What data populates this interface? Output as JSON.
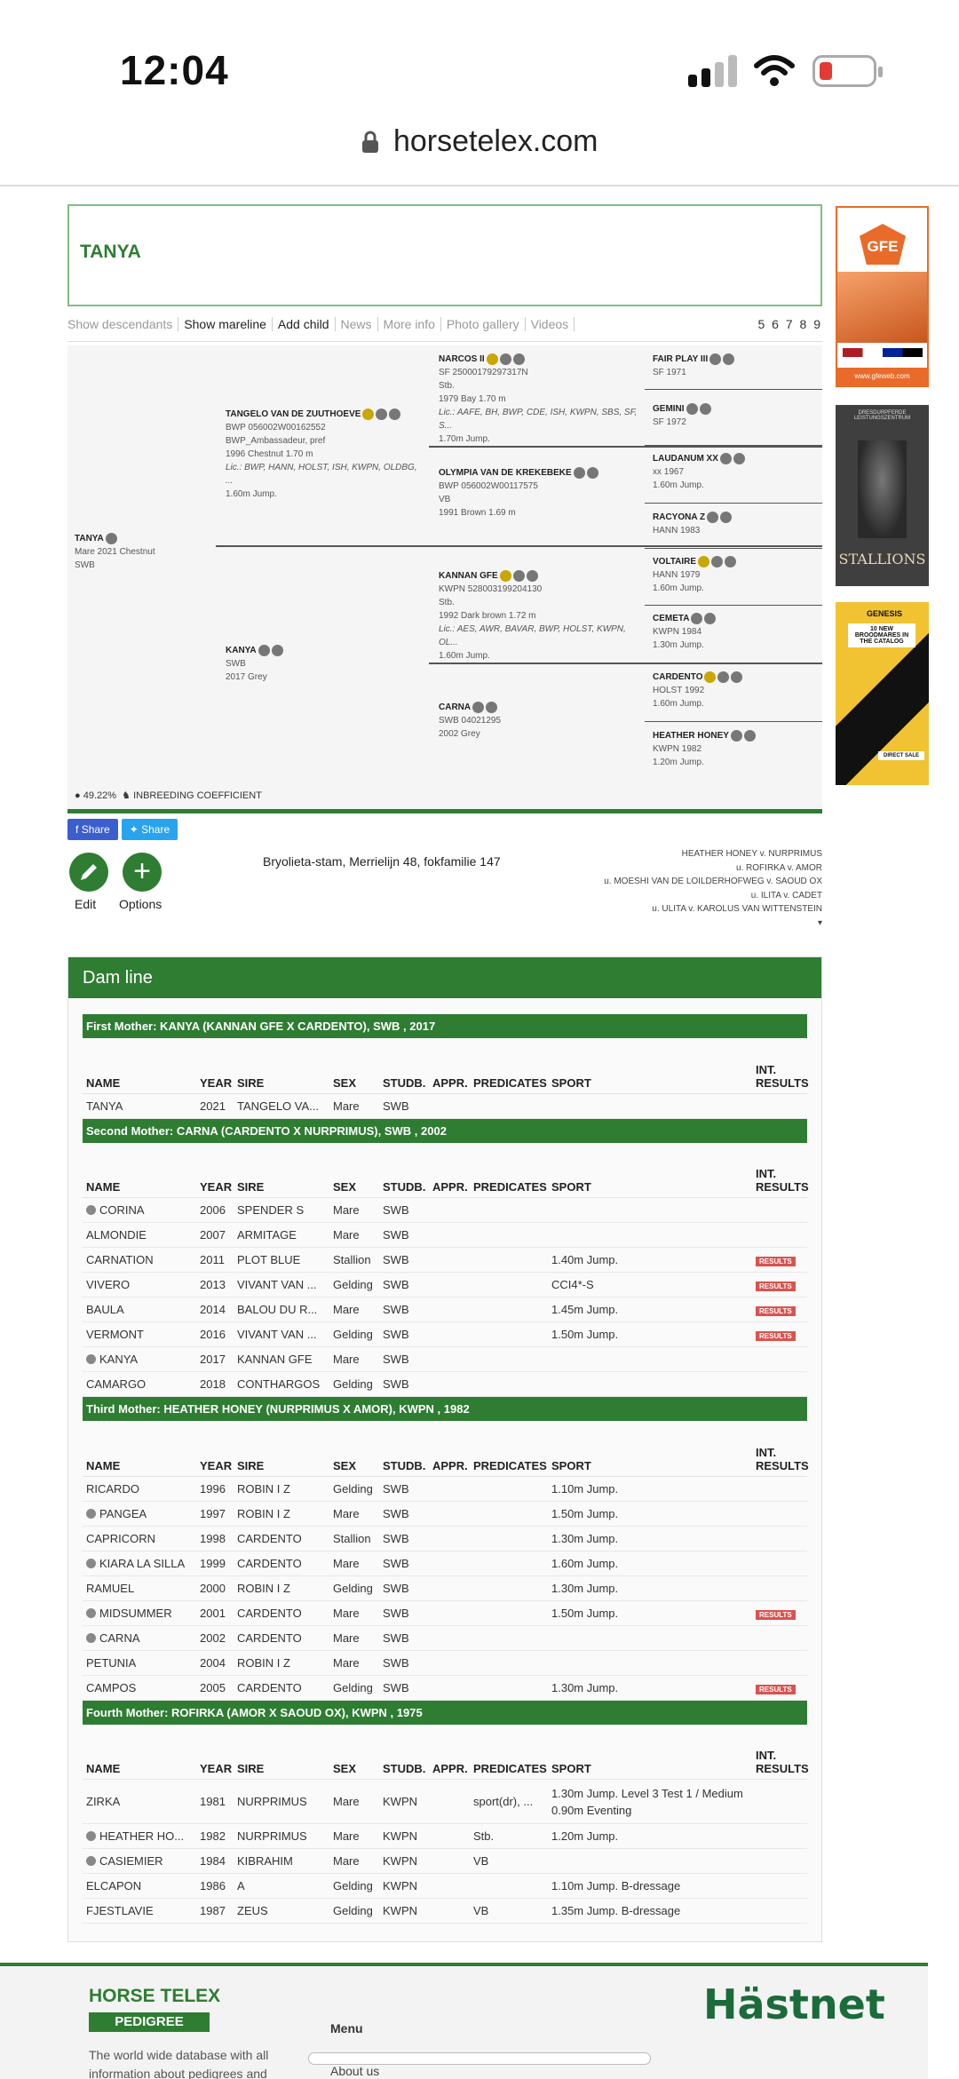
{
  "status": {
    "time": "12:04"
  },
  "browser": {
    "url": "horsetelex.com"
  },
  "horse": {
    "title": "TANYA"
  },
  "nav": {
    "items": [
      "Show descendants",
      "Show mareline",
      "Add child",
      "News",
      "More info",
      "Photo gallery",
      "Videos"
    ],
    "generations": "5 6 7 8 9"
  },
  "pedigree": {
    "subject": {
      "name": "TANYA",
      "line1": "Mare 2021 Chestnut",
      "line2": "SWB"
    },
    "sire": {
      "name": "TANGELO VAN DE ZUUTHOEVE",
      "l1": "BWP 056002W00162552",
      "l2": "BWP_Ambassadeur, pref",
      "l3": "1996 Chestnut 1.70 m",
      "lic": "Lic.: BWP, HANN, HOLST, ISH, KWPN, OLDBG, ...",
      "sport": "1.60m Jump."
    },
    "dam": {
      "name": "KANYA",
      "l1": "SWB",
      "l2": "2017 Grey"
    },
    "ss": {
      "name": "NARCOS II",
      "l1": "SF 25000179297317N",
      "l2": "Stb.",
      "l3": "1979 Bay 1.70 m",
      "lic": "Lic.: AAFE, BH, BWP, CDE, ISH, KWPN, SBS, SF, S...",
      "sport": "1.70m Jump."
    },
    "sd": {
      "name": "OLYMPIA VAN DE KREKEBEKE",
      "l1": "BWP 056002W00117575",
      "l2": "VB",
      "l3": "1991 Brown 1.69 m"
    },
    "ds": {
      "name": "KANNAN GFE",
      "l1": "KWPN 528003199204130",
      "l2": "Stb.",
      "l3": "1992 Dark brown 1.72 m",
      "lic": "Lic.: AES, AWR, BAVAR, BWP, HOLST, KWPN, OL...",
      "sport": "1.60m Jump."
    },
    "dd": {
      "name": "CARNA",
      "l1": "SWB 04021295",
      "l2": "2002 Grey"
    },
    "g3": [
      {
        "name": "FAIR PLAY III",
        "l1": "SF 1971",
        "l2": ""
      },
      {
        "name": "GEMINI",
        "l1": "SF 1972",
        "l2": ""
      },
      {
        "name": "LAUDANUM XX",
        "l1": "xx 1967",
        "l2": "1.60m Jump."
      },
      {
        "name": "RACYONA Z",
        "l1": "HANN 1983",
        "l2": ""
      },
      {
        "name": "VOLTAIRE",
        "l1": "HANN 1979",
        "l2": "1.60m Jump."
      },
      {
        "name": "CEMETA",
        "l1": "KWPN 1984",
        "l2": "1.30m Jump."
      },
      {
        "name": "CARDENTO",
        "l1": "HOLST 1992",
        "l2": "1.60m Jump."
      },
      {
        "name": "HEATHER HONEY",
        "l1": "KWPN 1982",
        "l2": "1.20m Jump."
      }
    ],
    "inbreeding_pct": "49.22%",
    "inbreeding_label": "INBREEDING COEFFICIENT"
  },
  "share": {
    "facebook": "Share",
    "twitter": "Share"
  },
  "actions": {
    "edit": "Edit",
    "options": "Options"
  },
  "stam": "Bryolieta-stam, Merrielijn 48, fokfamilie 147",
  "lineage": [
    "HEATHER HONEY v. NURPRIMUS",
    "u. ROFIRKA v. AMOR",
    "u. MOESHI VAN DE LOILDERHOFWEG v. SAOUD OX",
    "u. ILITA v. CADET",
    "u. ULITA v. KAROLUS VAN WITTENSTEIN"
  ],
  "damline": {
    "title": "Dam line",
    "columns": [
      "NAME",
      "YEAR",
      "SIRE",
      "SEX",
      "STUDB.",
      "APPR.",
      "PREDICATES",
      "SPORT",
      "INT. RESULTS"
    ],
    "results_label": "RESULTS",
    "mothers": [
      {
        "heading": "First Mother: KANYA (KANNAN GFE X CARDENTO), SWB , 2017",
        "rows": [
          {
            "star": false,
            "name": "TANYA",
            "year": "2021",
            "sire": "TANGELO VA...",
            "sex": "Mare",
            "studb": "SWB",
            "appr": "",
            "pred": "",
            "sport": "",
            "results": false
          }
        ]
      },
      {
        "heading": "Second Mother: CARNA (CARDENTO X NURPRIMUS), SWB , 2002",
        "rows": [
          {
            "star": true,
            "name": "CORINA",
            "year": "2006",
            "sire": "SPENDER S",
            "sex": "Mare",
            "studb": "SWB",
            "appr": "",
            "pred": "",
            "sport": "",
            "results": false
          },
          {
            "star": false,
            "name": "ALMONDIE",
            "year": "2007",
            "sire": "ARMITAGE",
            "sex": "Mare",
            "studb": "SWB",
            "appr": "",
            "pred": "",
            "sport": "",
            "results": false
          },
          {
            "star": false,
            "name": "CARNATION",
            "year": "2011",
            "sire": "PLOT BLUE",
            "sex": "Stallion",
            "studb": "SWB",
            "appr": "",
            "pred": "",
            "sport": "1.40m Jump.",
            "results": true
          },
          {
            "star": false,
            "name": "VIVERO",
            "year": "2013",
            "sire": "VIVANT VAN ...",
            "sex": "Gelding",
            "studb": "SWB",
            "appr": "",
            "pred": "",
            "sport": "CCI4*-S",
            "results": true
          },
          {
            "star": false,
            "name": "BAULA",
            "year": "2014",
            "sire": "BALOU DU R...",
            "sex": "Mare",
            "studb": "SWB",
            "appr": "",
            "pred": "",
            "sport": "1.45m Jump.",
            "results": true
          },
          {
            "star": false,
            "name": "VERMONT",
            "year": "2016",
            "sire": "VIVANT VAN ...",
            "sex": "Gelding",
            "studb": "SWB",
            "appr": "",
            "pred": "",
            "sport": "1.50m Jump.",
            "results": true
          },
          {
            "star": true,
            "name": "KANYA",
            "year": "2017",
            "sire": "KANNAN GFE",
            "sex": "Mare",
            "studb": "SWB",
            "appr": "",
            "pred": "",
            "sport": "",
            "results": false
          },
          {
            "star": false,
            "name": "CAMARGO",
            "year": "2018",
            "sire": "CONTHARGOS",
            "sex": "Gelding",
            "studb": "SWB",
            "appr": "",
            "pred": "",
            "sport": "",
            "results": false
          }
        ]
      },
      {
        "heading": "Third Mother: HEATHER HONEY (NURPRIMUS X AMOR), KWPN , 1982",
        "rows": [
          {
            "star": false,
            "name": "RICARDO",
            "year": "1996",
            "sire": "ROBIN I Z",
            "sex": "Gelding",
            "studb": "SWB",
            "appr": "",
            "pred": "",
            "sport": "1.10m Jump.",
            "results": false
          },
          {
            "star": true,
            "name": "PANGEA",
            "year": "1997",
            "sire": "ROBIN I Z",
            "sex": "Mare",
            "studb": "SWB",
            "appr": "",
            "pred": "",
            "sport": "1.50m Jump.",
            "results": false
          },
          {
            "star": false,
            "name": "CAPRICORN",
            "year": "1998",
            "sire": "CARDENTO",
            "sex": "Stallion",
            "studb": "SWB",
            "appr": "",
            "pred": "",
            "sport": "1.30m Jump.",
            "results": false
          },
          {
            "star": true,
            "name": "KIARA LA SILLA",
            "year": "1999",
            "sire": "CARDENTO",
            "sex": "Mare",
            "studb": "SWB",
            "appr": "",
            "pred": "",
            "sport": "1.60m Jump.",
            "results": false
          },
          {
            "star": false,
            "name": "RAMUEL",
            "year": "2000",
            "sire": "ROBIN I Z",
            "sex": "Gelding",
            "studb": "SWB",
            "appr": "",
            "pred": "",
            "sport": "1.30m Jump.",
            "results": false
          },
          {
            "star": true,
            "name": "MIDSUMMER",
            "year": "2001",
            "sire": "CARDENTO",
            "sex": "Mare",
            "studb": "SWB",
            "appr": "",
            "pred": "",
            "sport": "1.50m Jump.",
            "results": true
          },
          {
            "star": true,
            "name": "CARNA",
            "year": "2002",
            "sire": "CARDENTO",
            "sex": "Mare",
            "studb": "SWB",
            "appr": "",
            "pred": "",
            "sport": "",
            "results": false
          },
          {
            "star": false,
            "name": "PETUNIA",
            "year": "2004",
            "sire": "ROBIN I Z",
            "sex": "Mare",
            "studb": "SWB",
            "appr": "",
            "pred": "",
            "sport": "",
            "results": false
          },
          {
            "star": false,
            "name": "CAMPOS",
            "year": "2005",
            "sire": "CARDENTO",
            "sex": "Gelding",
            "studb": "SWB",
            "appr": "",
            "pred": "",
            "sport": "1.30m Jump.",
            "results": true
          }
        ]
      },
      {
        "heading": "Fourth Mother: ROFIRKA (AMOR X SAOUD OX), KWPN , 1975",
        "rows": [
          {
            "star": false,
            "name": "ZIRKA",
            "year": "1981",
            "sire": "NURPRIMUS",
            "sex": "Mare",
            "studb": "KWPN",
            "appr": "",
            "pred": "sport(dr), ...",
            "sport": "1.30m Jump. Level 3 Test 1 / Medium 0.90m Eventing",
            "results": false,
            "tall": true
          },
          {
            "star": true,
            "name": "HEATHER HO...",
            "year": "1982",
            "sire": "NURPRIMUS",
            "sex": "Mare",
            "studb": "KWPN",
            "appr": "",
            "pred": "Stb.",
            "sport": "1.20m Jump.",
            "results": false
          },
          {
            "star": true,
            "name": "CASIEMIER",
            "year": "1984",
            "sire": "KIBRAHIM",
            "sex": "Mare",
            "studb": "KWPN",
            "appr": "",
            "pred": "VB",
            "sport": "",
            "results": false
          },
          {
            "star": false,
            "name": "ELCAPON",
            "year": "1986",
            "sire": "A",
            "sex": "Gelding",
            "studb": "KWPN",
            "appr": "",
            "pred": "",
            "sport": "1.10m Jump. B-dressage",
            "results": false
          },
          {
            "star": false,
            "name": "FJESTLAVIE",
            "year": "1987",
            "sire": "ZEUS",
            "sex": "Gelding",
            "studb": "KWPN",
            "appr": "",
            "pred": "VB",
            "sport": "1.35m Jump. B-dressage",
            "results": false
          }
        ]
      }
    ]
  },
  "ads": {
    "ad1": {
      "brand": "GFE",
      "url": "www.gfeweb.com"
    },
    "ad2": {
      "text_top": "DRESDURPFERDE LEISTUNGSZENTRUM",
      "text": "STALLIONS"
    },
    "ad3": {
      "brand": "GENESIS",
      "headline": "10 NEW BROODMARES IN THE CATALOG",
      "tag": "DIRECT SALE"
    }
  },
  "footer": {
    "logo_top": "HORSE TELEX",
    "logo_bottom": "PEDIGREE",
    "description": "The world wide database with all information about pedigrees and",
    "menu": "Menu",
    "about": "About us",
    "partner": "Hästnet"
  }
}
